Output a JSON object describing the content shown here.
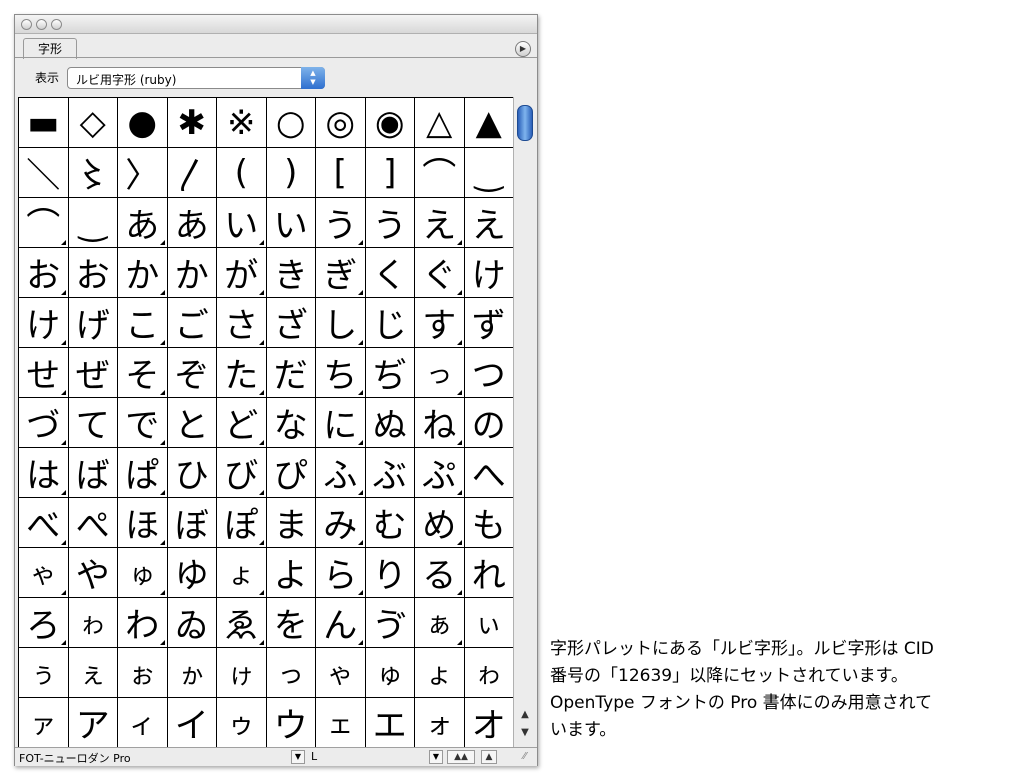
{
  "panel": {
    "tab_label": "字形",
    "flyout_icon": "flyout-menu-icon",
    "show_label": "表示",
    "show_value": "ルビ用字形 (ruby)"
  },
  "glyphs": [
    "▬",
    "◇",
    "●",
    "✱",
    "※",
    "○",
    "◎",
    "◉",
    "△",
    "▲",
    "＼",
    "〻",
    "〉",
    "〳",
    "(",
    ")",
    "[",
    "]",
    "⌒",
    "‿",
    "⌒",
    "‿",
    "あ",
    "あ",
    "い",
    "い",
    "う",
    "う",
    "え",
    "え",
    "お",
    "お",
    "か",
    "か",
    "が",
    "き",
    "ぎ",
    "く",
    "ぐ",
    "け",
    "け",
    "げ",
    "こ",
    "ご",
    "さ",
    "ざ",
    "し",
    "じ",
    "す",
    "ず",
    "せ",
    "ぜ",
    "そ",
    "ぞ",
    "た",
    "だ",
    "ち",
    "ぢ",
    "っ",
    "つ",
    "づ",
    "て",
    "で",
    "と",
    "ど",
    "な",
    "に",
    "ぬ",
    "ね",
    "の",
    "は",
    "ば",
    "ぱ",
    "ひ",
    "び",
    "ぴ",
    "ふ",
    "ぶ",
    "ぷ",
    "へ",
    "べ",
    "ぺ",
    "ほ",
    "ぼ",
    "ぽ",
    "ま",
    "み",
    "む",
    "め",
    "も",
    "ゃ",
    "や",
    "ゅ",
    "ゆ",
    "ょ",
    "よ",
    "ら",
    "り",
    "る",
    "れ",
    "ろ",
    "ゎ",
    "わ",
    "ゐ",
    "ゑ",
    "を",
    "ん",
    "ゔ",
    "ぁ",
    "ぃ",
    "ぅ",
    "ぇ",
    "ぉ",
    "ゕ",
    "ゖ",
    "っ",
    "ゃ",
    "ゅ",
    "ょ",
    "ゎ",
    "ァ",
    "ア",
    "ィ",
    "イ",
    "ゥ",
    "ウ",
    "ェ",
    "エ",
    "ォ",
    "オ"
  ],
  "status": {
    "font_name": "FOT-ニューロダン Pro",
    "style_name": "L"
  },
  "caption": {
    "line1": "字形パレットにある「ルビ字形」。ルビ字形は CID",
    "line2": "番号の「12639」以降にセットされています。",
    "line3": "OpenType フォントの Pro 書体にのみ用意されて",
    "line4": "います。"
  }
}
